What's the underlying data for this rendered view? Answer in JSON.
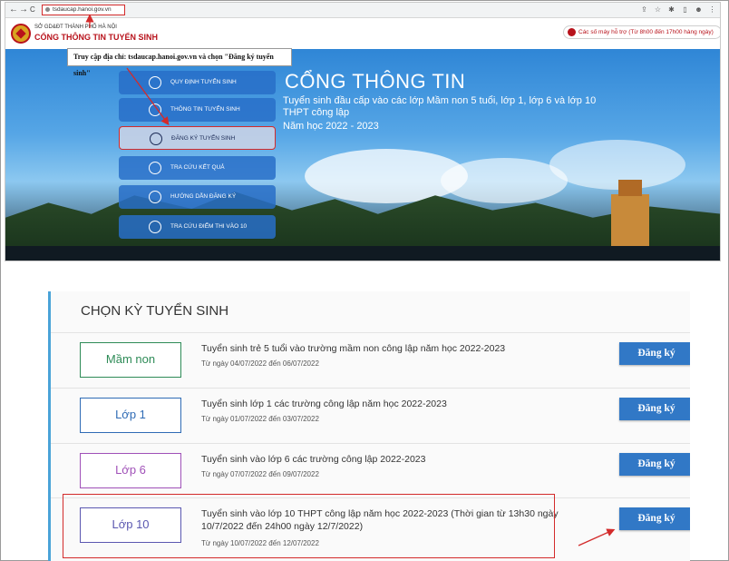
{
  "browser": {
    "url": "tsdaucap.hanoi.gov.vn",
    "nav": [
      "←",
      "→",
      "C"
    ]
  },
  "site": {
    "org": "SỞ GD&ĐT THÀNH PHỐ HÀ NỘI",
    "portal": "CỔNG THÔNG TIN TUYỂN SINH",
    "hotline": "Các số máy hỗ trợ (Từ 8h00 đến 17h00 hàng ngày)"
  },
  "callout": "Truy cập địa chỉ: tsdaucap.hanoi.gov.vn và chọn \"Đăng ký tuyển sinh\"",
  "hero": {
    "title": "CỔNG THÔNG TIN",
    "subtitle": "Tuyển sinh đầu cấp vào các lớp Mầm non 5 tuổi, lớp 1, lớp 6 và lớp 10 THPT công lập",
    "year": "Năm học 2022 - 2023"
  },
  "menu": [
    {
      "label": "QUY ĐỊNH TUYỂN SINH",
      "icon": "document-icon"
    },
    {
      "label": "THÔNG TIN TUYỂN SINH",
      "icon": "info-icon"
    },
    {
      "label": "ĐĂNG KÝ TUYỂN SINH",
      "icon": "register-icon"
    },
    {
      "label": "TRA CỨU KẾT QUẢ",
      "icon": "search-result-icon"
    },
    {
      "label": "HƯỚNG DẪN ĐĂNG KÝ",
      "icon": "guide-icon"
    },
    {
      "label": "TRA CỨU ĐIỂM THI VÀO 10",
      "icon": "score-icon"
    }
  ],
  "section_title": "CHỌN KỲ TUYỂN SINH",
  "rows": [
    {
      "grade": "Mầm non",
      "color": "#2e8b57",
      "title": "Tuyển sinh trẻ 5 tuổi vào trường mầm non công lập năm học 2022-2023",
      "date": "Từ ngày 04/07/2022 đến 06/07/2022",
      "button": "Đăng ký"
    },
    {
      "grade": "Lớp 1",
      "color": "#2f6bb5",
      "title": "Tuyển sinh lớp 1 các trường công lập năm học 2022-2023",
      "date": "Từ ngày 01/07/2022 đến 03/07/2022",
      "button": "Đăng ký"
    },
    {
      "grade": "Lớp 6",
      "color": "#a051b8",
      "title": "Tuyển sinh vào lớp 6 các trường công lập 2022-2023",
      "date": "Từ ngày 07/07/2022 đến 09/07/2022",
      "button": "Đăng ký"
    },
    {
      "grade": "Lớp 10",
      "color": "#5a57b0",
      "title": "Tuyển sinh vào lớp 10 THPT công lập năm học 2022-2023 (Thời gian từ 13h30 ngày 10/7/2022 đến 24h00 ngày 12/7/2022)",
      "date": "Từ ngày 10/07/2022 đến 12/07/2022",
      "button": "Đăng ký"
    }
  ],
  "colors": {
    "accent": "#3178c6",
    "highlight": "#d32b2b"
  }
}
